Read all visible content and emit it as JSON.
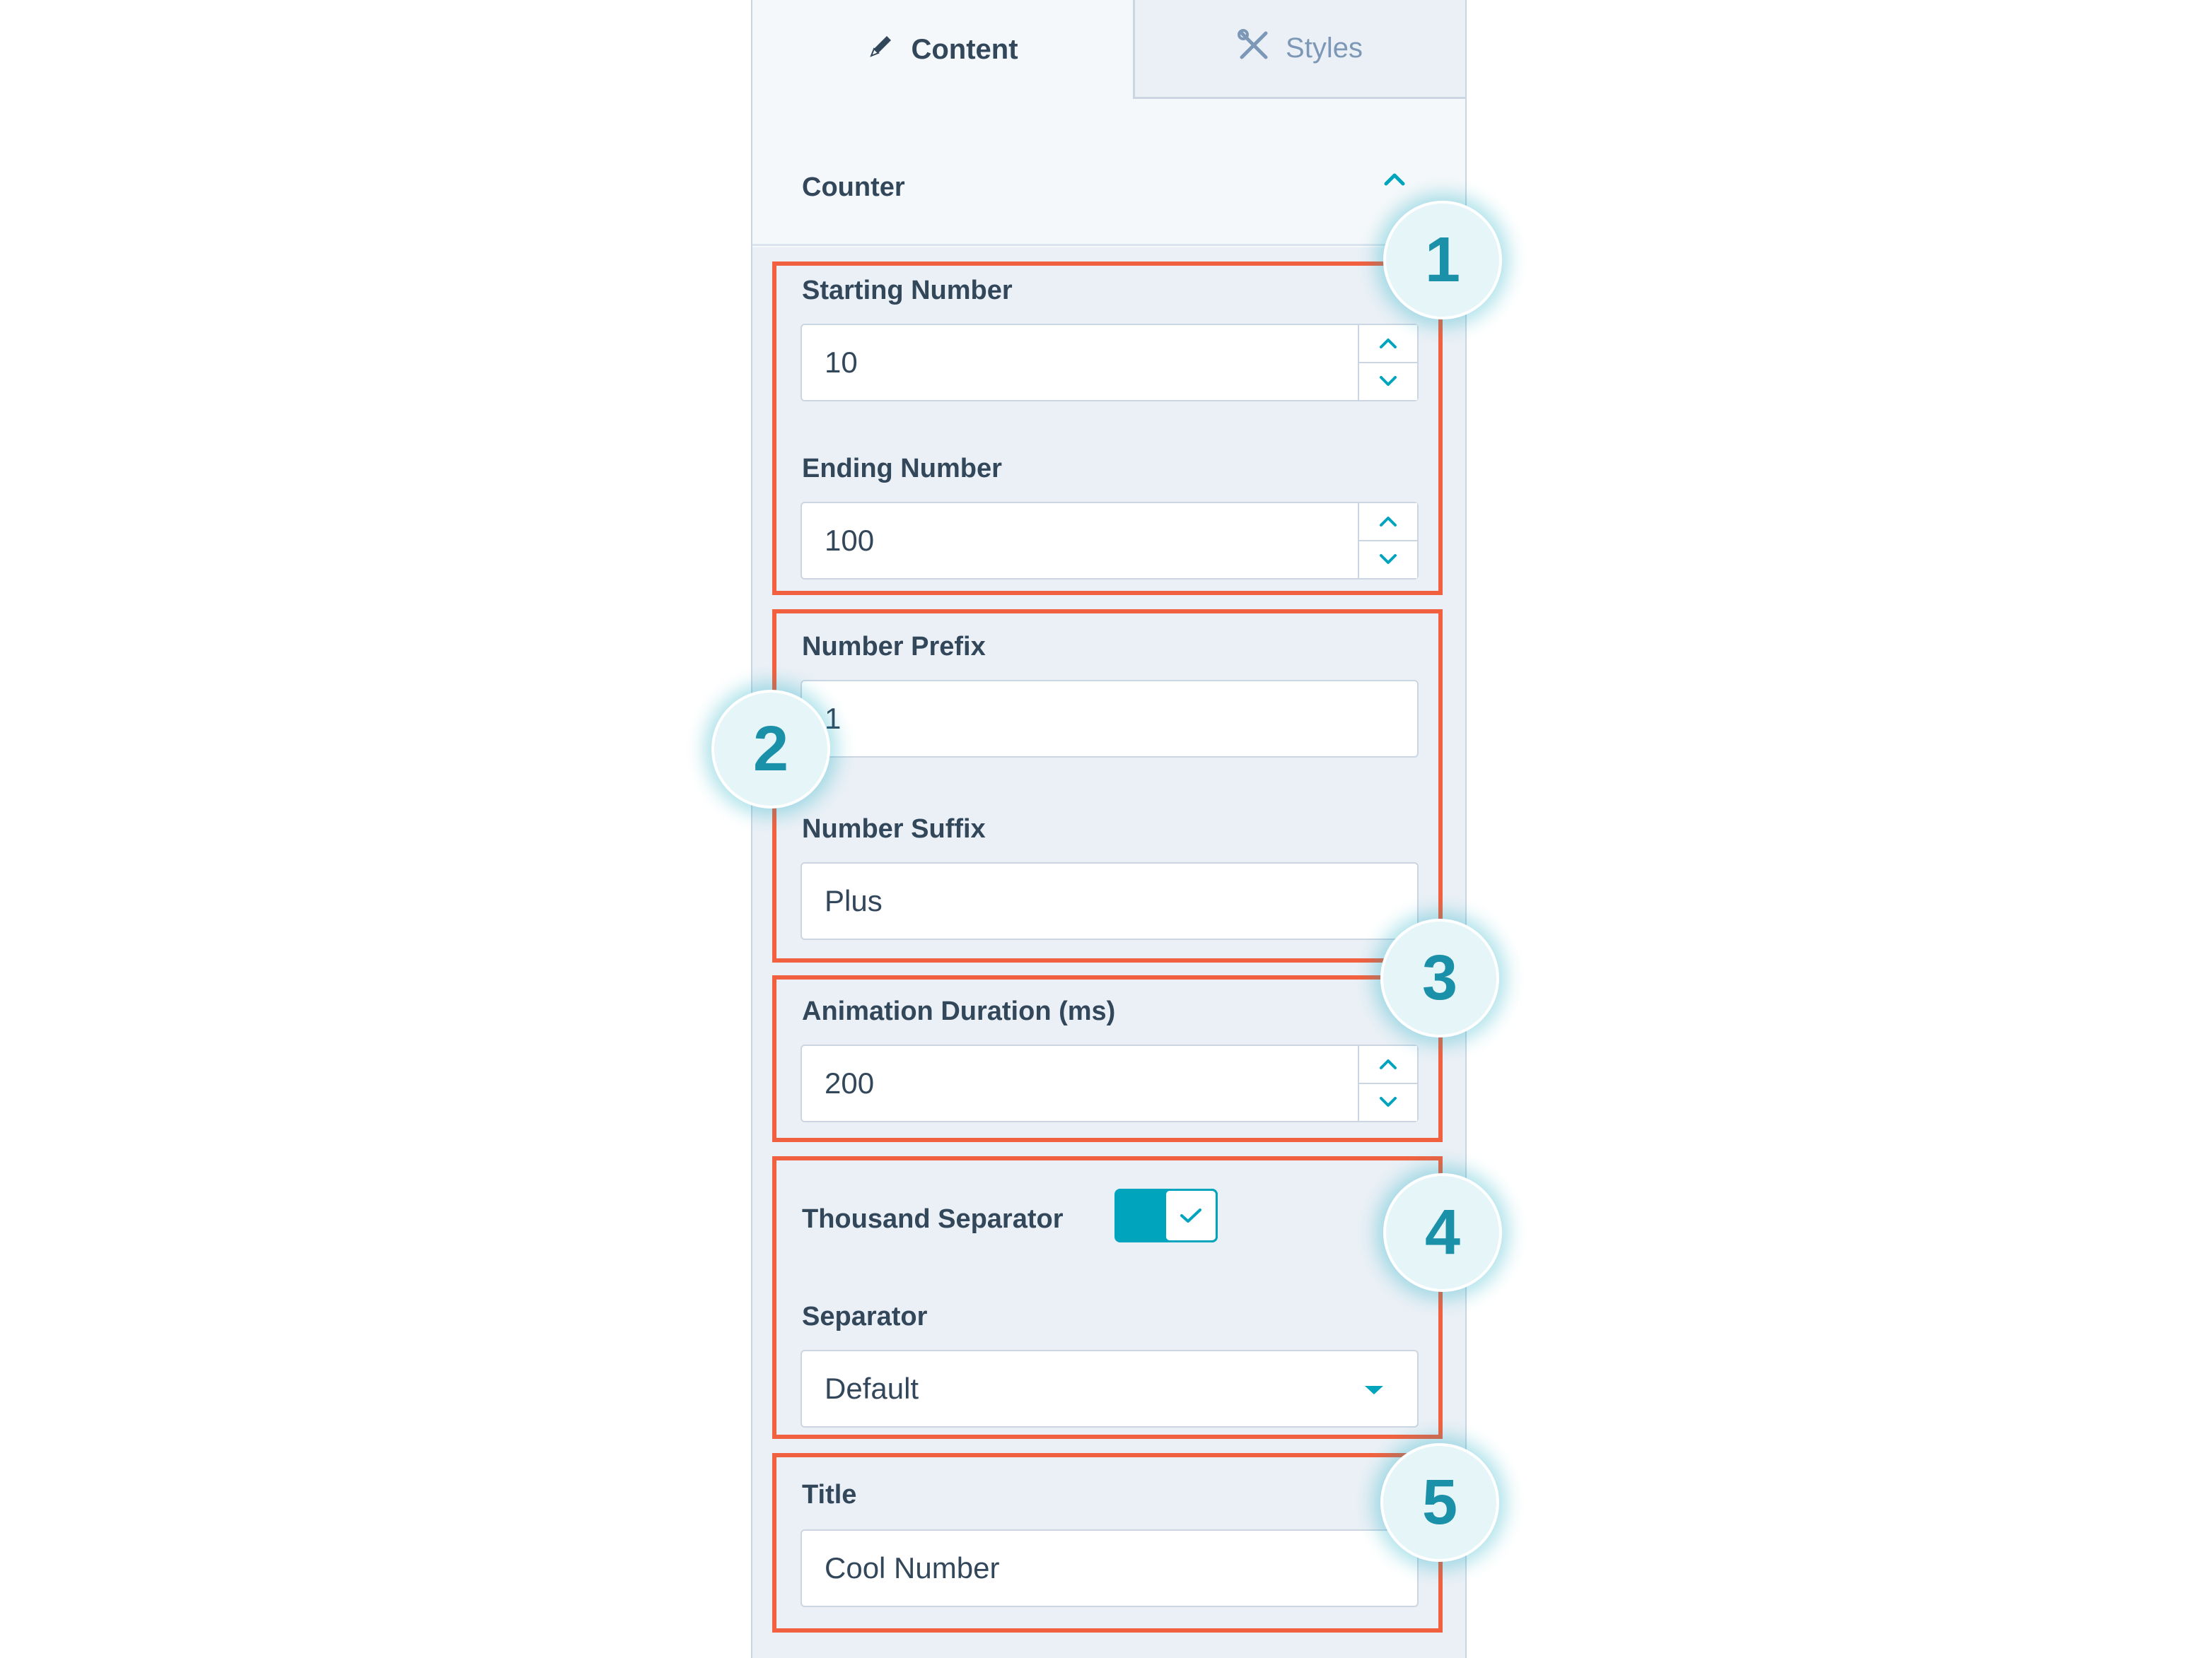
{
  "tabs": {
    "content_label": "Content",
    "styles_label": "Styles"
  },
  "section": {
    "title": "Counter"
  },
  "fields": {
    "starting_number": {
      "label": "Starting Number",
      "value": "10"
    },
    "ending_number": {
      "label": "Ending Number",
      "value": "100"
    },
    "number_prefix": {
      "label": "Number Prefix",
      "value": "1"
    },
    "number_suffix": {
      "label": "Number Suffix",
      "value": "Plus"
    },
    "animation_duration": {
      "label": "Animation Duration (ms)",
      "value": "200"
    },
    "thousand_separator": {
      "label": "Thousand Separator",
      "enabled": true
    },
    "separator": {
      "label": "Separator",
      "selected": "Default"
    },
    "title": {
      "label": "Title",
      "value": "Cool Number"
    }
  },
  "callouts": [
    "1",
    "2",
    "3",
    "4",
    "5"
  ],
  "colors": {
    "accent": "#00a4bd",
    "highlight": "#f2613f",
    "badge_text": "#1a90a9"
  },
  "icons": {
    "content_tab": "pencil-icon",
    "styles_tab": "tools-icon",
    "collapse": "chevron-up-icon",
    "step_up": "chevron-up-icon",
    "step_down": "chevron-down-icon",
    "dropdown": "caret-down-icon",
    "toggle": "checkmark-icon"
  }
}
